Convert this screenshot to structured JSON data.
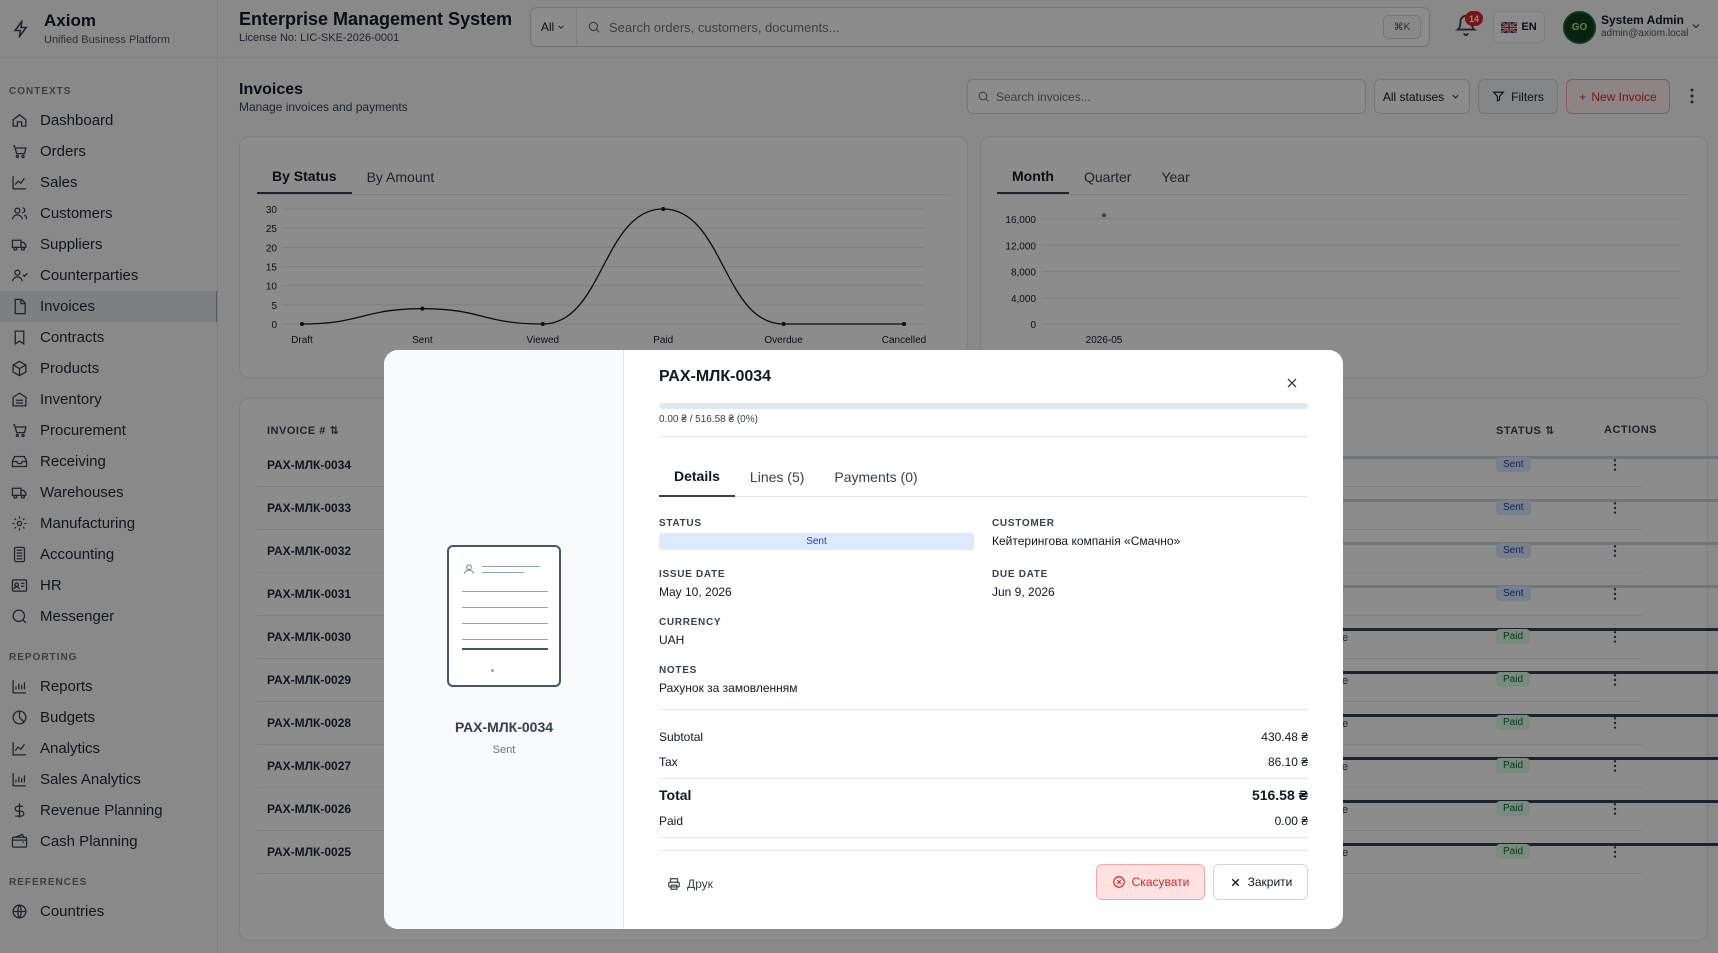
{
  "brand": {
    "name": "Axiom",
    "subtitle": "Unified Business Platform"
  },
  "header": {
    "title": "Enterprise Management System",
    "license": "License No: LIC-SKE-2026-0001",
    "search_scope": "All",
    "search_placeholder": "Search orders, customers, documents...",
    "search_shortcut": "⌘K",
    "notifications": "14",
    "language": "EN",
    "avatar_text": "GO",
    "user_name": "System Admin",
    "user_email": "admin@axiom.local"
  },
  "sidebar": {
    "sections": [
      {
        "title": "CONTEXTS",
        "items": [
          "Dashboard",
          "Orders",
          "Sales",
          "Customers",
          "Suppliers",
          "Counterparties",
          "Invoices",
          "Contracts",
          "Products",
          "Inventory",
          "Procurement",
          "Receiving",
          "Warehouses",
          "Manufacturing",
          "Accounting",
          "HR",
          "Messenger"
        ]
      },
      {
        "title": "REPORTING",
        "items": [
          "Reports",
          "Budgets",
          "Analytics",
          "Sales Analytics",
          "Revenue Planning",
          "Cash Planning"
        ]
      },
      {
        "title": "REFERENCES",
        "items": [
          "Countries"
        ]
      }
    ],
    "active": "Invoices"
  },
  "page": {
    "title": "Invoices",
    "subtitle": "Manage invoices and payments",
    "search_placeholder": "Search invoices...",
    "status_filter": "All statuses",
    "filters_label": "Filters",
    "new_label": "New Invoice"
  },
  "status_chart": {
    "tabs": [
      "By Status",
      "By Amount"
    ],
    "active_tab": "By Status"
  },
  "period_chart": {
    "tabs": [
      "Month",
      "Quarter",
      "Year"
    ],
    "active_tab": "Month"
  },
  "chart_data": [
    {
      "type": "line",
      "categories": [
        "Draft",
        "Sent",
        "Viewed",
        "Paid",
        "Overdue",
        "Cancelled"
      ],
      "values": [
        0,
        4,
        0,
        30,
        0,
        0
      ],
      "yticks": [
        0,
        5,
        10,
        15,
        20,
        25,
        30
      ],
      "ylim": [
        0,
        30
      ],
      "grid": true
    },
    {
      "type": "scatter",
      "categories": [
        "2026-05"
      ],
      "values": [
        16580
      ],
      "yticks": [
        0,
        4000,
        8000,
        12000,
        16000
      ],
      "ytick_labels": [
        "0",
        "4,000",
        "8,000",
        "12,000",
        "16,000"
      ],
      "ylim": [
        0,
        16000
      ],
      "grid": true
    }
  ],
  "table": {
    "headers": {
      "invoice": "INVOICE #",
      "status": "STATUS",
      "actions": "ACTIONS"
    },
    "rows": [
      {
        "id": "РАХ-МЛК-0034",
        "status": "Sent",
        "kind": "sent",
        "paid_fraction": 0,
        "partial": ""
      },
      {
        "id": "РАХ-МЛК-0033",
        "status": "Sent",
        "kind": "sent",
        "paid_fraction": 0,
        "partial": ""
      },
      {
        "id": "РАХ-МЛК-0032",
        "status": "Sent",
        "kind": "sent",
        "paid_fraction": 0,
        "partial": ""
      },
      {
        "id": "РАХ-МЛК-0031",
        "status": "Sent",
        "kind": "sent",
        "paid_fraction": 0,
        "partial": ""
      },
      {
        "id": "РАХ-МЛК-0030",
        "status": "Paid",
        "kind": "paid",
        "paid_fraction": 1,
        "partial": "e"
      },
      {
        "id": "РАХ-МЛК-0029",
        "status": "Paid",
        "kind": "paid",
        "paid_fraction": 1,
        "partial": "e"
      },
      {
        "id": "РАХ-МЛК-0028",
        "status": "Paid",
        "kind": "paid",
        "paid_fraction": 1,
        "partial": "e"
      },
      {
        "id": "РАХ-МЛК-0027",
        "status": "Paid",
        "kind": "paid",
        "paid_fraction": 1,
        "partial": "e"
      },
      {
        "id": "РАХ-МЛК-0026",
        "status": "Paid",
        "kind": "paid",
        "paid_fraction": 1,
        "partial": "e"
      },
      {
        "id": "РАХ-МЛК-0025",
        "status": "Paid",
        "kind": "paid",
        "paid_fraction": 1,
        "partial": "e"
      }
    ]
  },
  "modal": {
    "preview_id": "РАХ-МЛК-0034",
    "preview_status": "Sent",
    "title": "РАХ-МЛК-0034",
    "progress_text": "0.00 ₴ / 516.58 ₴ (0%)",
    "progress_fraction": 0,
    "tabs": [
      "Details",
      "Lines (5)",
      "Payments (0)"
    ],
    "active_tab": "Details",
    "labels": {
      "status": "STATUS",
      "customer": "CUSTOMER",
      "issue_date": "ISSUE DATE",
      "due_date": "DUE DATE",
      "currency": "CURRENCY",
      "notes": "NOTES"
    },
    "status": "Sent",
    "customer": "Кейтерингова компанія «Смачно»",
    "issue_date": "May 10, 2026",
    "due_date": "Jun 9, 2026",
    "currency": "UAH",
    "notes": "Рахунок за замовленням",
    "summary": {
      "subtotal_label": "Subtotal",
      "subtotal": "430.48 ₴",
      "tax_label": "Tax",
      "tax": "86.10 ₴",
      "total_label": "Total",
      "total": "516.58 ₴",
      "paid_label": "Paid",
      "paid": "0.00 ₴"
    },
    "print_label": "Друк",
    "cancel_label": "Скасувати",
    "close_label": "Закрити"
  },
  "colors": {
    "accent": "#334155",
    "danger": "#dc2626",
    "sent_bg": "#dbeafe",
    "paid_bg": "#dcfce7"
  }
}
